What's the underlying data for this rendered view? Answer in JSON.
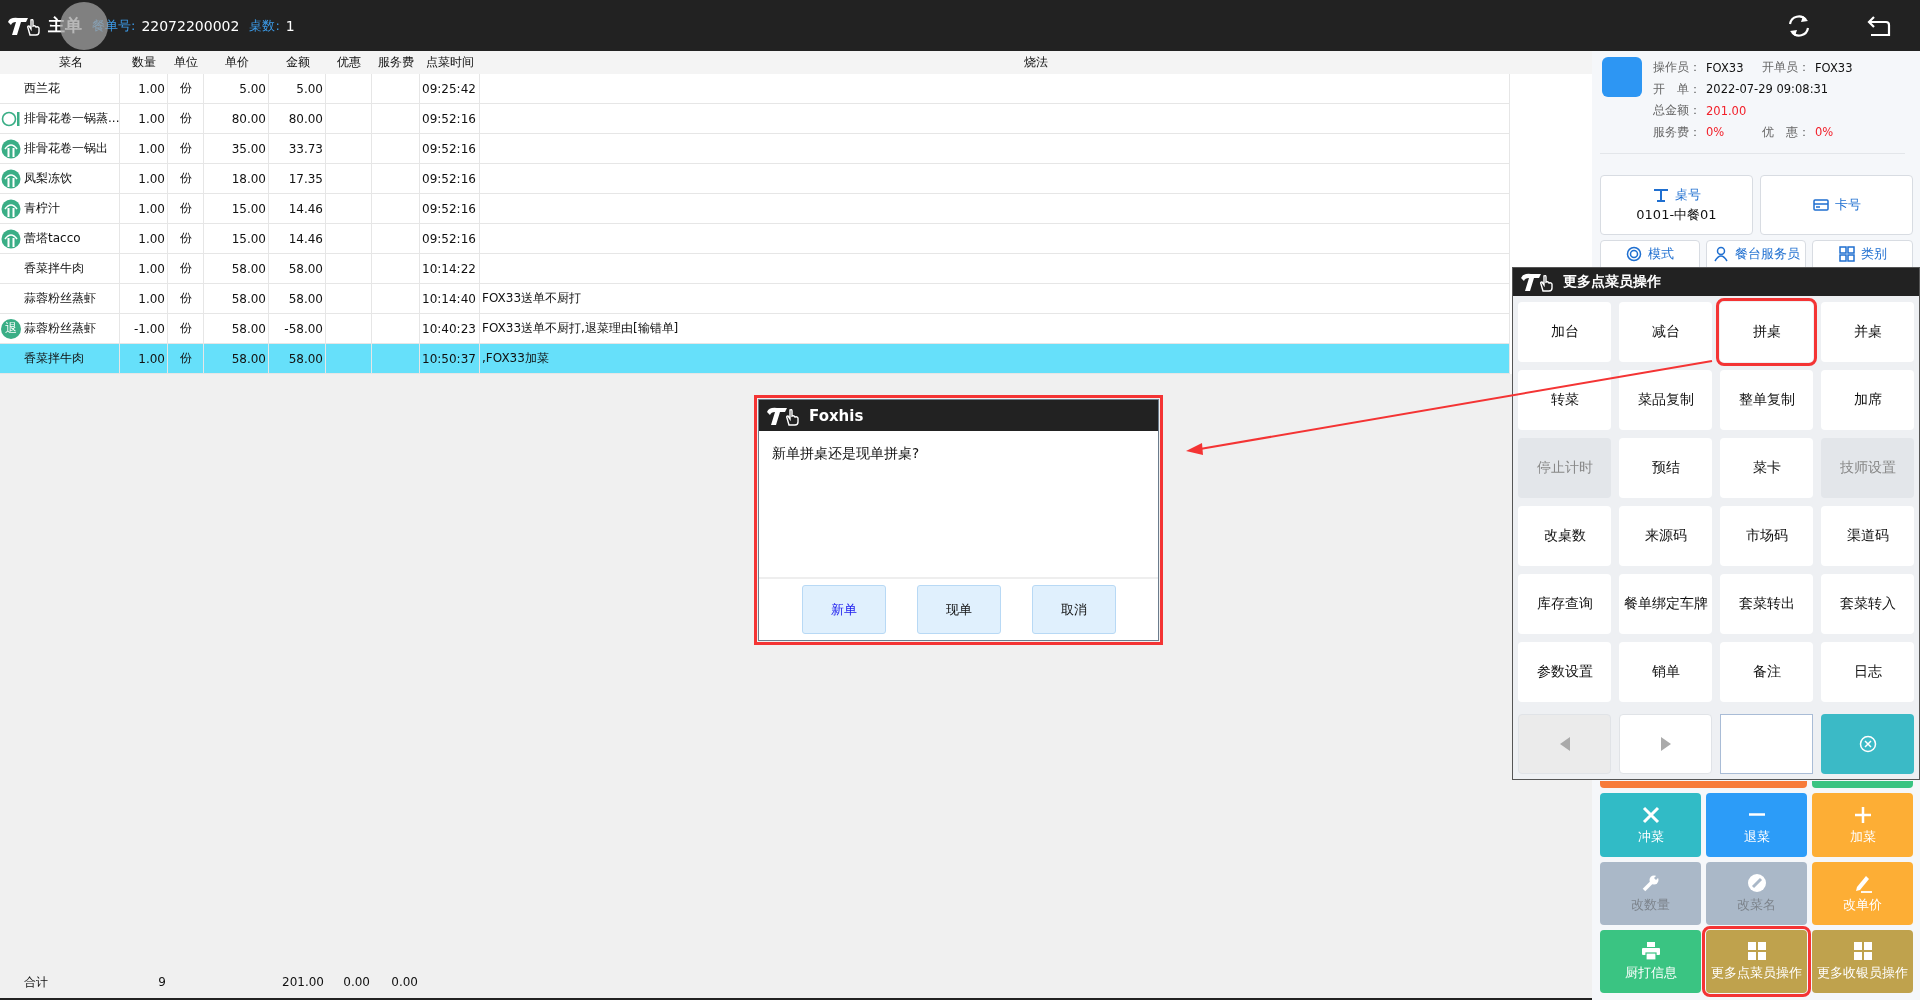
{
  "header": {
    "title": "主单",
    "order_label": "餐单号:",
    "order_no": "22072200002",
    "tables_label": "桌数:",
    "tables": "1"
  },
  "table": {
    "columns": [
      "菜名",
      "数量",
      "单位",
      "单价",
      "金额",
      "优惠",
      "服务费",
      "点菜时间",
      "烧法"
    ],
    "rows": [
      {
        "kind": "none",
        "name": "西兰花",
        "qty": "1.00",
        "unit": "份",
        "price": "5.00",
        "amount": "5.00",
        "time": "09:25:42",
        "selected": false
      },
      {
        "kind": "hollow",
        "name": "排骨花卷一锅蒸...",
        "qty": "1.00",
        "unit": "份",
        "price": "80.00",
        "amount": "80.00",
        "time": "09:52:16",
        "selected": false
      },
      {
        "kind": "dish",
        "name": "排骨花卷一锅出",
        "qty": "1.00",
        "unit": "份",
        "price": "35.00",
        "amount": "33.73",
        "time": "09:52:16",
        "selected": false
      },
      {
        "kind": "dish",
        "name": "凤梨冻饮",
        "qty": "1.00",
        "unit": "份",
        "price": "18.00",
        "amount": "17.35",
        "time": "09:52:16",
        "selected": false
      },
      {
        "kind": "dish",
        "name": "青柠汁",
        "qty": "1.00",
        "unit": "份",
        "price": "15.00",
        "amount": "14.46",
        "time": "09:52:16",
        "selected": false
      },
      {
        "kind": "dish",
        "name": "蕾塔tacco",
        "qty": "1.00",
        "unit": "份",
        "price": "15.00",
        "amount": "14.46",
        "time": "09:52:16",
        "selected": false
      },
      {
        "kind": "none",
        "name": "香菜拌牛肉",
        "qty": "1.00",
        "unit": "份",
        "price": "58.00",
        "amount": "58.00",
        "time": "10:14:22",
        "selected": false
      },
      {
        "kind": "none",
        "name": "蒜蓉粉丝蒸虾",
        "qty": "1.00",
        "unit": "份",
        "price": "58.00",
        "amount": "58.00",
        "time": "10:14:40",
        "method": "FOX33送单不厨打",
        "selected": false
      },
      {
        "kind": "return",
        "badge": "退",
        "name": "蒜蓉粉丝蒸虾",
        "qty": "-1.00",
        "unit": "份",
        "price": "58.00",
        "amount": "-58.00",
        "time": "10:40:23",
        "method": "FOX33送单不厨打,退菜理由[输错单]",
        "selected": false
      },
      {
        "kind": "none",
        "name": "香菜拌牛肉",
        "qty": "1.00",
        "unit": "份",
        "price": "58.00",
        "amount": "58.00",
        "time": "10:50:37",
        "method": ",FOX33加菜",
        "selected": true
      }
    ],
    "totals": {
      "label": "合计",
      "qty": "9",
      "amount": "201.00",
      "discount": "0.00",
      "service": "0.00"
    }
  },
  "info": {
    "operator_label": "操作员：",
    "operator": "FOX33",
    "opener_label": "开单员：",
    "opener": "FOX33",
    "open_label": "开　单：",
    "open_time": "2022-07-29 09:08:31",
    "total_label": "总金额：",
    "total": "201.00",
    "service_label": "服务费：",
    "service": "0%",
    "discount_label": "优　惠：",
    "discount": "0%"
  },
  "panel_buttons": [
    {
      "kind": "table",
      "label": "桌号",
      "value": "0101-中餐01"
    },
    {
      "kind": "card",
      "label": "卡号"
    }
  ],
  "panel_tabs": [
    {
      "kind": "ring",
      "label": "模式"
    },
    {
      "kind": "person",
      "label": "餐台服务员"
    },
    {
      "kind": "grid",
      "label": "类别"
    }
  ],
  "actions": [
    {
      "kind": "cross",
      "label": "冲菜",
      "color": "#31bbc6",
      "disabled": false,
      "highlighted": false
    },
    {
      "kind": "minus",
      "label": "退菜",
      "color": "#2c9cf8",
      "disabled": false,
      "highlighted": false
    },
    {
      "kind": "plus",
      "label": "加菜",
      "color": "#fdae35",
      "disabled": false,
      "highlighted": false
    },
    {
      "kind": "wrench",
      "label": "改数量",
      "color": "#aab8c8",
      "disabled": true,
      "highlighted": false
    },
    {
      "kind": "edit",
      "label": "改菜名",
      "color": "#aab8c8",
      "disabled": true,
      "highlighted": false
    },
    {
      "kind": "pen",
      "label": "改单价",
      "color": "#fdae35",
      "disabled": false,
      "highlighted": false
    },
    {
      "kind": "printer",
      "label": "厨打信息",
      "color": "#3ac482",
      "disabled": false,
      "highlighted": false
    },
    {
      "kind": "grid",
      "label": "更多点菜员操作",
      "color": "#bfa24d",
      "disabled": false,
      "highlighted": true
    },
    {
      "kind": "grid",
      "label": "更多收银员操作",
      "color": "#bfa24d",
      "disabled": false,
      "highlighted": false
    }
  ],
  "popup": {
    "title": "更多点菜员操作",
    "buttons": [
      {
        "label": "加台",
        "disabled": false,
        "highlighted": false
      },
      {
        "label": "减台",
        "disabled": false,
        "highlighted": false
      },
      {
        "label": "拼桌",
        "disabled": false,
        "highlighted": true
      },
      {
        "label": "并桌",
        "disabled": false,
        "highlighted": false
      },
      {
        "label": "转菜",
        "disabled": false,
        "highlighted": false
      },
      {
        "label": "菜品复制",
        "disabled": false,
        "highlighted": false
      },
      {
        "label": "整单复制",
        "disabled": false,
        "highlighted": false
      },
      {
        "label": "加席",
        "disabled": false,
        "highlighted": false
      },
      {
        "label": "停止计时",
        "disabled": true,
        "highlighted": false
      },
      {
        "label": "预结",
        "disabled": false,
        "highlighted": false
      },
      {
        "label": "菜卡",
        "disabled": false,
        "highlighted": false
      },
      {
        "label": "技师设置",
        "disabled": true,
        "highlighted": false
      },
      {
        "label": "改桌数",
        "disabled": false,
        "highlighted": false
      },
      {
        "label": "来源码",
        "disabled": false,
        "highlighted": false
      },
      {
        "label": "市场码",
        "disabled": false,
        "highlighted": false
      },
      {
        "label": "渠道码",
        "disabled": false,
        "highlighted": false
      },
      {
        "label": "库存查询",
        "disabled": false,
        "highlighted": false
      },
      {
        "label": "餐单绑定车牌",
        "disabled": false,
        "highlighted": false
      },
      {
        "label": "套菜转出",
        "disabled": false,
        "highlighted": false
      },
      {
        "label": "套菜转入",
        "disabled": false,
        "highlighted": false
      },
      {
        "label": "参数设置",
        "disabled": false,
        "highlighted": false
      },
      {
        "label": "销单",
        "disabled": false,
        "highlighted": false
      },
      {
        "label": "备注",
        "disabled": false,
        "highlighted": false
      },
      {
        "label": "日志",
        "disabled": false,
        "highlighted": false
      }
    ],
    "nav": [
      {
        "kind": "prev",
        "disabled": true
      },
      {
        "kind": "next",
        "disabled": false
      }
    ]
  },
  "dialog": {
    "title": "Foxhis",
    "message": "新单拼桌还是现单拼桌?",
    "highlighted": true,
    "buttons": [
      {
        "label": "新单",
        "focused": true
      },
      {
        "label": "现单",
        "focused": false
      },
      {
        "label": "取消",
        "focused": false
      }
    ]
  }
}
